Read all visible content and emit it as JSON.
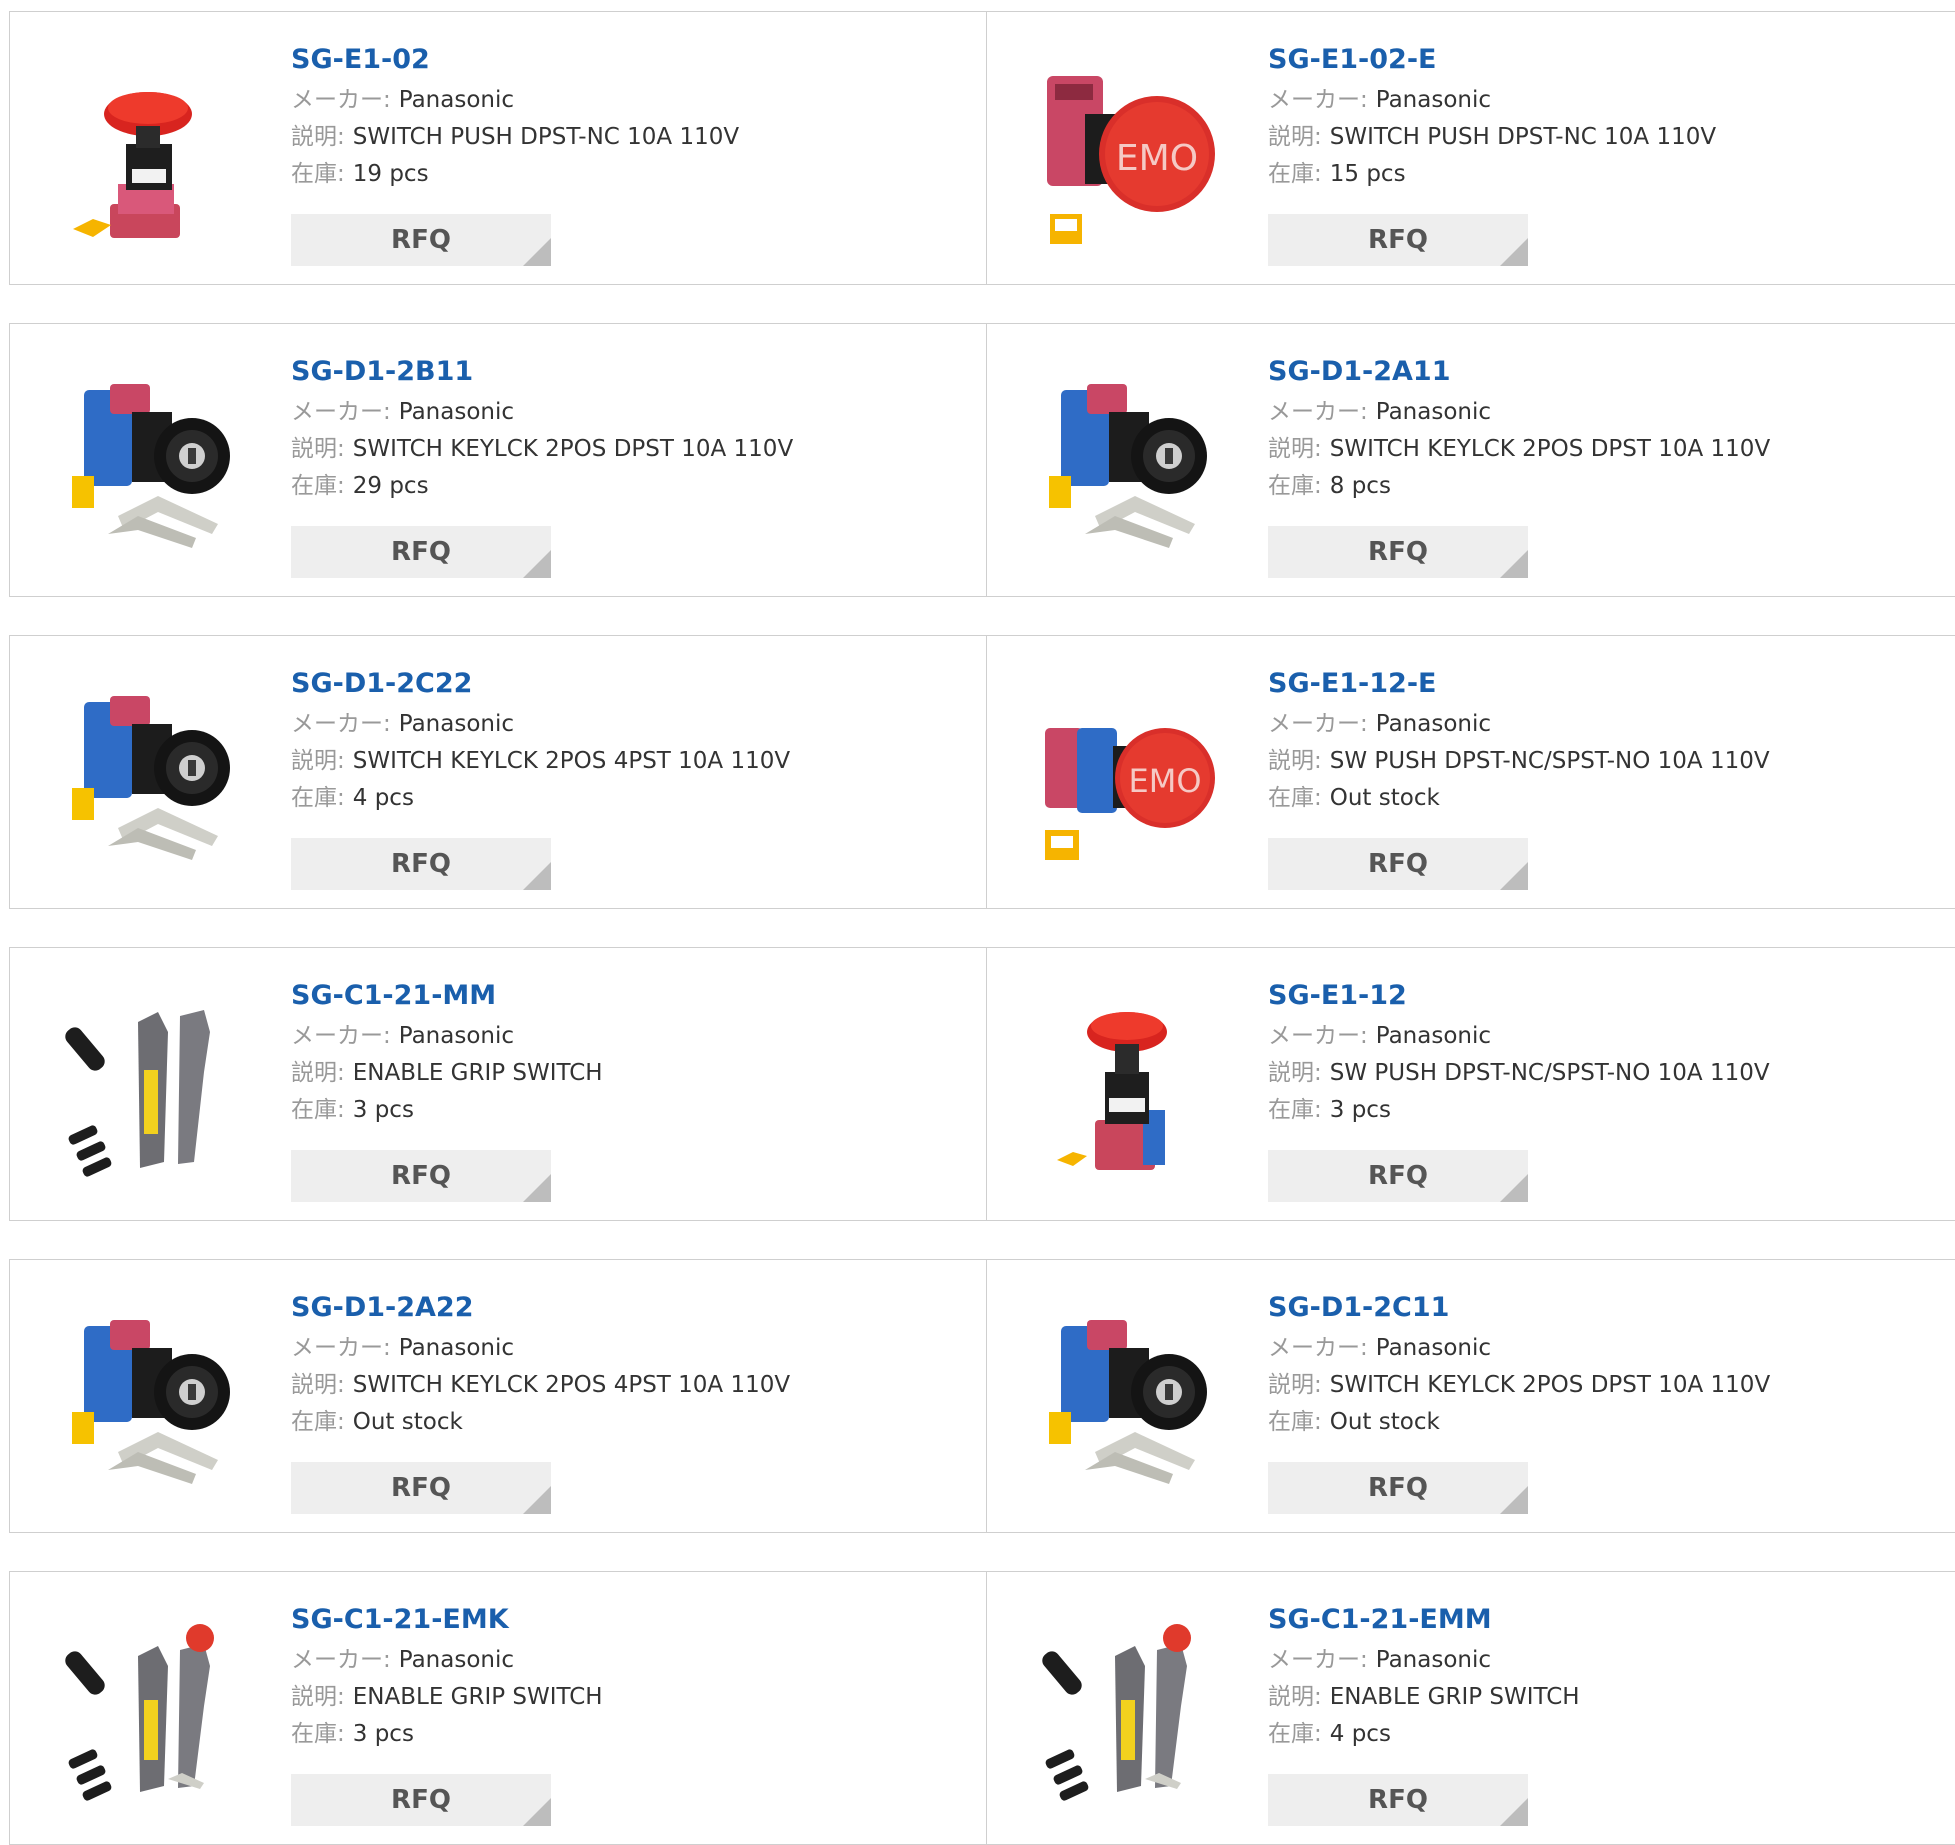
{
  "labels": {
    "maker": "メーカー:",
    "desc": "説明:",
    "stock": "在庫:",
    "rfq": "RFQ"
  },
  "colors": {
    "link": "#1a5fac",
    "label": "#999999",
    "button_bg": "#eeeeee"
  },
  "products": [
    {
      "part": "SG-E1-02",
      "maker": "Panasonic",
      "desc": "SWITCH PUSH DPST-NC 10A 110V",
      "stock": "19 pcs",
      "image": "emergency-stop-red-base"
    },
    {
      "part": "SG-E1-02-E",
      "maker": "Panasonic",
      "desc": "SWITCH PUSH DPST-NC 10A 110V",
      "stock": "15 pcs",
      "image": "emo-red-button"
    },
    {
      "part": "SG-D1-2B11",
      "maker": "Panasonic",
      "desc": "SWITCH KEYLCK 2POS DPST 10A 110V",
      "stock": "29 pcs",
      "image": "key-switch-blue"
    },
    {
      "part": "SG-D1-2A11",
      "maker": "Panasonic",
      "desc": "SWITCH KEYLCK 2POS DPST 10A 110V",
      "stock": "8 pcs",
      "image": "key-switch-blue"
    },
    {
      "part": "SG-D1-2C22",
      "maker": "Panasonic",
      "desc": "SWITCH KEYLCK 2POS 4PST 10A 110V",
      "stock": "4 pcs",
      "image": "key-switch-blue"
    },
    {
      "part": "SG-E1-12-E",
      "maker": "Panasonic",
      "desc": "SW PUSH DPST-NC/SPST-NO 10A 110V",
      "stock": "Out stock",
      "image": "emo-red-button-blue"
    },
    {
      "part": "SG-C1-21-MM",
      "maker": "Panasonic",
      "desc": "ENABLE GRIP SWITCH",
      "stock": "3 pcs",
      "image": "enable-grip"
    },
    {
      "part": "SG-E1-12",
      "maker": "Panasonic",
      "desc": "SW PUSH DPST-NC/SPST-NO 10A 110V",
      "stock": "3 pcs",
      "image": "emergency-stop-red-blue"
    },
    {
      "part": "SG-D1-2A22",
      "maker": "Panasonic",
      "desc": "SWITCH KEYLCK 2POS 4PST 10A 110V",
      "stock": "Out stock",
      "image": "key-switch-blue"
    },
    {
      "part": "SG-D1-2C11",
      "maker": "Panasonic",
      "desc": "SWITCH KEYLCK 2POS DPST 10A 110V",
      "stock": "Out stock",
      "image": "key-switch-blue"
    },
    {
      "part": "SG-C1-21-EMK",
      "maker": "Panasonic",
      "desc": "ENABLE GRIP SWITCH",
      "stock": "3 pcs",
      "image": "enable-grip-estop"
    },
    {
      "part": "SG-C1-21-EMM",
      "maker": "Panasonic",
      "desc": "ENABLE GRIP SWITCH",
      "stock": "4 pcs",
      "image": "enable-grip-estop"
    }
  ]
}
